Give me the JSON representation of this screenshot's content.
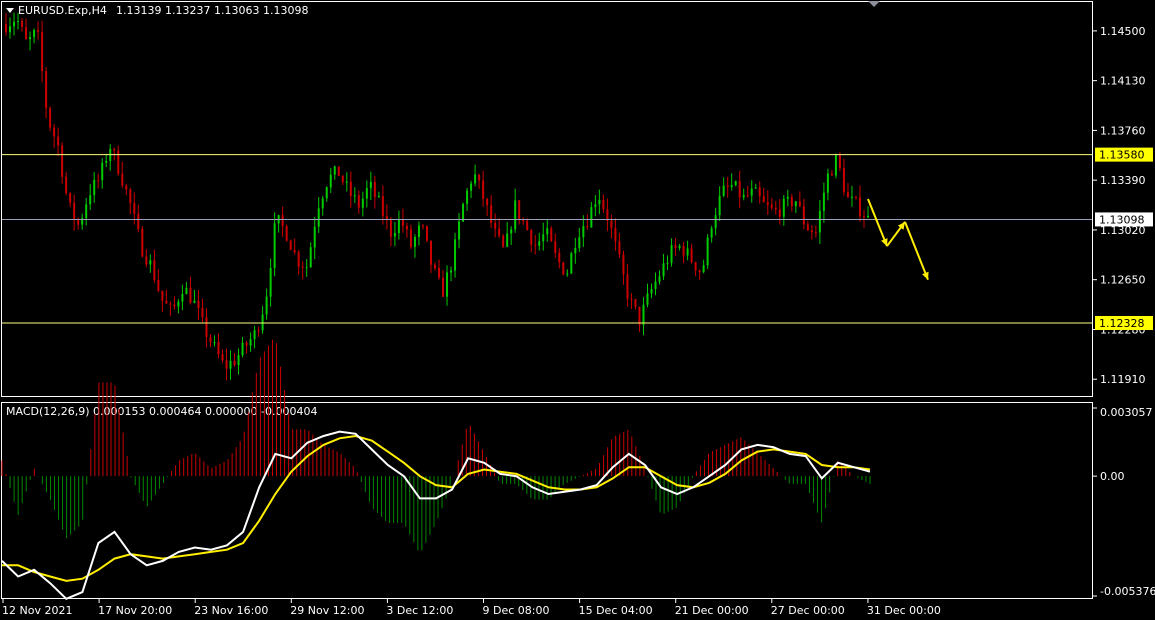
{
  "header": {
    "symbol": "EURUSD.Exp,H4",
    "ohlc": "1.13139 1.13237 1.13063 1.13098"
  },
  "macd_header": "MACD(12,26,9) 0.000153 0.000464 0.000000 -0.000404",
  "colors": {
    "background": "#000000",
    "bull": "#00cc00",
    "bear": "#cc0000",
    "level": "#ffff80",
    "current": "#9aa0b8",
    "arrow": "#ffee00",
    "macd_main": "#ffffff",
    "macd_signal": "#ffee00",
    "hist_pos": "#cc0000",
    "hist_neg": "#008800"
  },
  "price_axis": {
    "ticks": [
      "1.14500",
      "1.14130",
      "1.13760",
      "1.13390",
      "1.13020",
      "1.12650",
      "1.12280",
      "1.11910"
    ],
    "resistance_label": "1.13580",
    "current_label": "1.13098",
    "support_label": "1.12328"
  },
  "macd_axis": {
    "ticks": [
      "0.003057",
      "0.00",
      "-0.005376"
    ]
  },
  "time_axis": [
    "12 Nov 2021",
    "17 Nov 20:00",
    "23 Nov 16:00",
    "29 Nov 12:00",
    "3 Dec 12:00",
    "9 Dec 08:00",
    "15 Dec 04:00",
    "21 Dec 00:00",
    "27 Dec 00:00",
    "31 Dec 00:00"
  ],
  "chart_data": {
    "type": "line",
    "symbol": "EURUSD.Exp",
    "timeframe": "H4",
    "price_range": [
      1.118,
      1.147
    ],
    "horizontal_levels": [
      1.1358,
      1.12328
    ],
    "current_price": 1.13098,
    "price_path": [
      1.1455,
      1.146,
      1.144,
      1.145,
      1.1385,
      1.1365,
      1.132,
      1.1305,
      1.133,
      1.134,
      1.1365,
      1.1345,
      1.132,
      1.129,
      1.1275,
      1.125,
      1.124,
      1.126,
      1.125,
      1.123,
      1.1215,
      1.12,
      1.1205,
      1.1215,
      1.1225,
      1.125,
      1.131,
      1.13,
      1.128,
      1.1275,
      1.132,
      1.134,
      1.1345,
      1.133,
      1.132,
      1.1335,
      1.132,
      1.13,
      1.131,
      1.129,
      1.1305,
      1.1275,
      1.1255,
      1.128,
      1.132,
      1.1345,
      1.1325,
      1.13,
      1.1285,
      1.132,
      1.1305,
      1.129,
      1.13,
      1.128,
      1.127,
      1.13,
      1.131,
      1.133,
      1.131,
      1.128,
      1.125,
      1.1235,
      1.1255,
      1.127,
      1.1285,
      1.129,
      1.128,
      1.127,
      1.131,
      1.133,
      1.1335,
      1.1325,
      1.133,
      1.132,
      1.1315,
      1.132,
      1.1325,
      1.1305,
      1.13,
      1.134,
      1.1355,
      1.1325,
      1.132,
      1.131
    ],
    "forecast_path": [
      1.1325,
      1.129,
      1.1308,
      1.1265
    ],
    "macd_range": [
      -0.005376,
      0.003057
    ],
    "macd_main": [
      -0.0038,
      -0.0045,
      -0.0042,
      -0.0048,
      -0.0055,
      -0.0052,
      -0.003,
      -0.0025,
      -0.0035,
      -0.004,
      -0.0038,
      -0.0034,
      -0.0032,
      -0.0033,
      -0.0031,
      -0.0025,
      -0.0005,
      0.001,
      0.0008,
      0.0015,
      0.0018,
      0.002,
      0.0019,
      0.0012,
      0.0005,
      0.0,
      -0.001,
      -0.001,
      -0.0006,
      0.0008,
      0.0006,
      0.0001,
      0.0,
      -0.0005,
      -0.0008,
      -0.0007,
      -0.0006,
      -0.0004,
      0.0004,
      0.001,
      0.0005,
      -0.0005,
      -0.0008,
      -0.0005,
      0.0,
      0.0005,
      0.0012,
      0.0014,
      0.0013,
      0.001,
      0.0009,
      -0.0001,
      0.0006,
      0.0004,
      0.0002
    ],
    "macd_signal": [
      -0.004,
      -0.004,
      -0.0043,
      -0.0045,
      -0.0047,
      -0.0046,
      -0.0042,
      -0.0037,
      -0.0035,
      -0.0036,
      -0.0037,
      -0.0036,
      -0.0035,
      -0.0034,
      -0.0033,
      -0.003,
      -0.002,
      -0.0008,
      0.0002,
      0.0009,
      0.0014,
      0.0017,
      0.0018,
      0.0016,
      0.0011,
      0.0006,
      0.0,
      -0.0004,
      -0.0005,
      0.0001,
      0.0003,
      0.0002,
      0.0001,
      -0.0002,
      -0.0005,
      -0.0006,
      -0.0006,
      -0.0005,
      -0.0001,
      0.0004,
      0.0004,
      0.0,
      -0.0004,
      -0.0005,
      -0.0003,
      0.0001,
      0.0007,
      0.0011,
      0.0012,
      0.0011,
      0.001,
      0.0005,
      0.0004,
      0.0004,
      0.0003
    ]
  }
}
